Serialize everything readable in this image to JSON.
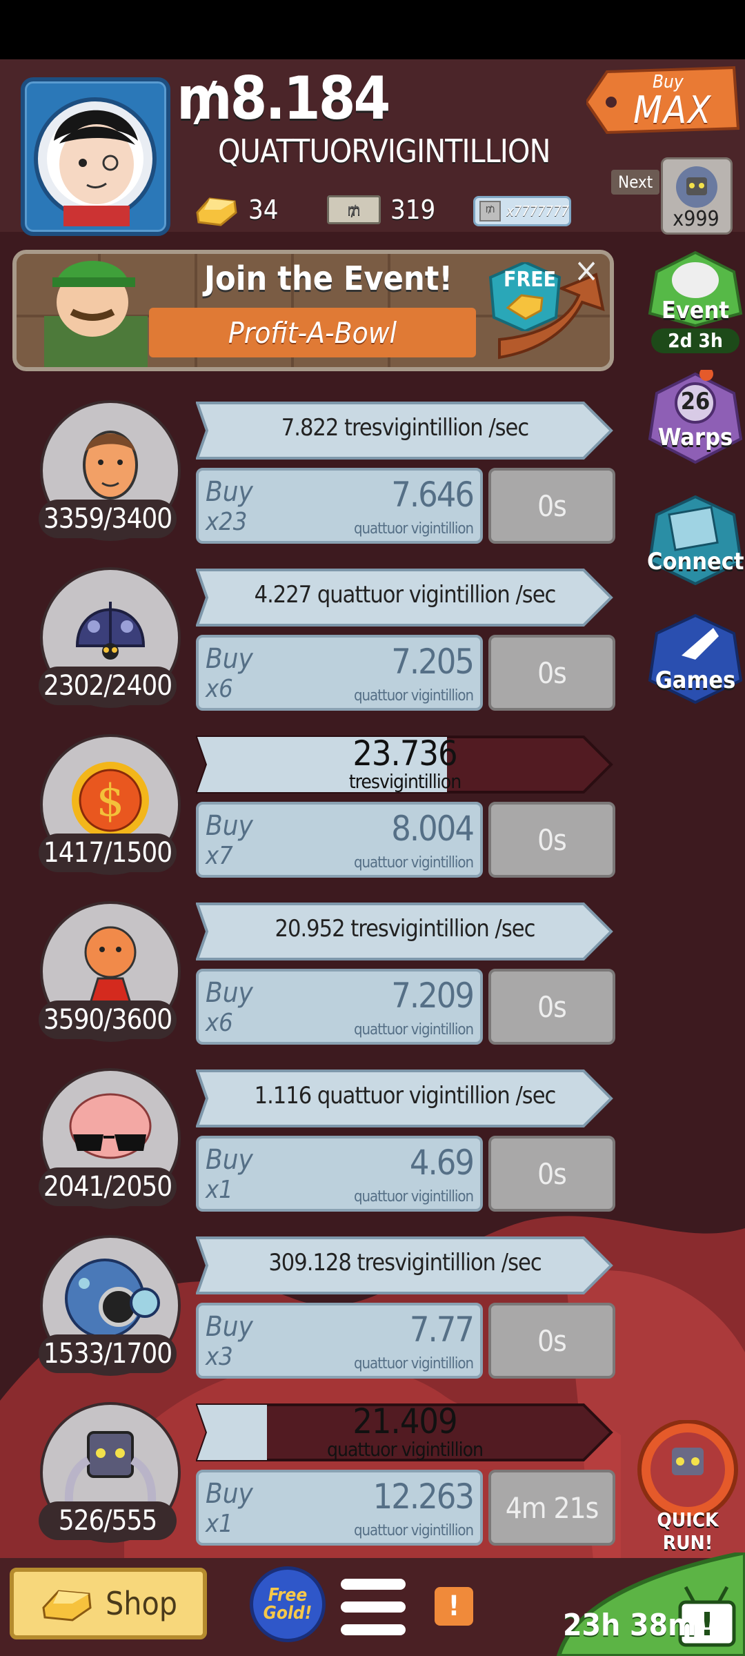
{
  "header": {
    "money_symbol": "₥",
    "money_value": "8.184",
    "money_unit": "QUATTUORVIGINTILLION",
    "gold_count": "34",
    "megabucks_count": "319",
    "megaticket_label": "x7777777",
    "buy_top": "Buy",
    "buy_bottom": "MAX",
    "next_label": "Next",
    "next_multiplier": "x999"
  },
  "event_banner": {
    "title": "Join the Event!",
    "subtitle": "Profit-A-Bowl",
    "free_label": "FREE",
    "close_label": "×"
  },
  "side_buttons": {
    "event": {
      "label": "Event",
      "time": "2d 3h"
    },
    "warps": {
      "count": "26",
      "label": "Warps"
    },
    "connect": {
      "label": "Connect"
    },
    "games": {
      "label": "Games"
    }
  },
  "businesses": [
    {
      "icon": "face-icon",
      "count": "3359/3400",
      "rate": "7.822 tresvigintillion /sec",
      "buy_label": "Buy",
      "buy_qty": "x23",
      "cost": "7.646",
      "cost_unit": "quattuor vigintillion",
      "timer": "0s",
      "colors": {
        "accent": "#f2a066"
      }
    },
    {
      "icon": "ladybug-icon",
      "count": "2302/2400",
      "rate": "4.227 quattuor vigintillion /sec",
      "buy_label": "Buy",
      "buy_qty": "x6",
      "cost": "7.205",
      "cost_unit": "quattuor vigintillion",
      "timer": "0s",
      "colors": {
        "accent": "#3b3f7a"
      }
    },
    {
      "icon": "dollar-sun-icon",
      "count": "1417/1500",
      "progress_value": "23.736",
      "progress_unit": "tresvigintillion",
      "progress_fraction": 0.6,
      "buy_label": "Buy",
      "buy_qty": "x7",
      "cost": "8.004",
      "cost_unit": "quattuor vigintillion",
      "timer": "0s",
      "colors": {
        "accent": "#e9571f"
      }
    },
    {
      "icon": "heart-robot-icon",
      "count": "3590/3600",
      "rate": "20.952 tresvigintillion /sec",
      "buy_label": "Buy",
      "buy_qty": "x6",
      "cost": "7.209",
      "cost_unit": "quattuor vigintillion",
      "timer": "0s",
      "colors": {
        "accent": "#e4441f"
      }
    },
    {
      "icon": "brain-sunglasses-icon",
      "count": "2041/2050",
      "rate": "1.116 quattuor vigintillion /sec",
      "buy_label": "Buy",
      "buy_qty": "x1",
      "cost": "4.69",
      "cost_unit": "quattuor vigintillion",
      "timer": "0s",
      "colors": {
        "accent": "#f3a8a4"
      }
    },
    {
      "icon": "diving-helmet-icon",
      "count": "1533/1700",
      "rate": "309.128 tresvigintillion /sec",
      "buy_label": "Buy",
      "buy_qty": "x3",
      "cost": "7.77",
      "cost_unit": "quattuor vigintillion",
      "timer": "0s",
      "colors": {
        "accent": "#4a79b8"
      }
    },
    {
      "icon": "robot-spider-icon",
      "count": "526/555",
      "progress_value": "21.409",
      "progress_unit": "quattuor vigintillion",
      "progress_fraction": 0.17,
      "buy_label": "Buy",
      "buy_qty": "x1",
      "cost": "12.263",
      "cost_unit": "quattuor vigintillion",
      "timer": "4m 21s",
      "colors": {
        "accent": "#5a5a78"
      }
    }
  ],
  "quick_run": {
    "label": "QUICK RUN!"
  },
  "bottom_bar": {
    "shop_label": "Shop",
    "free_gold_label": "Free Gold!",
    "alert_label": "!",
    "tv_timer": "23h 38m"
  }
}
